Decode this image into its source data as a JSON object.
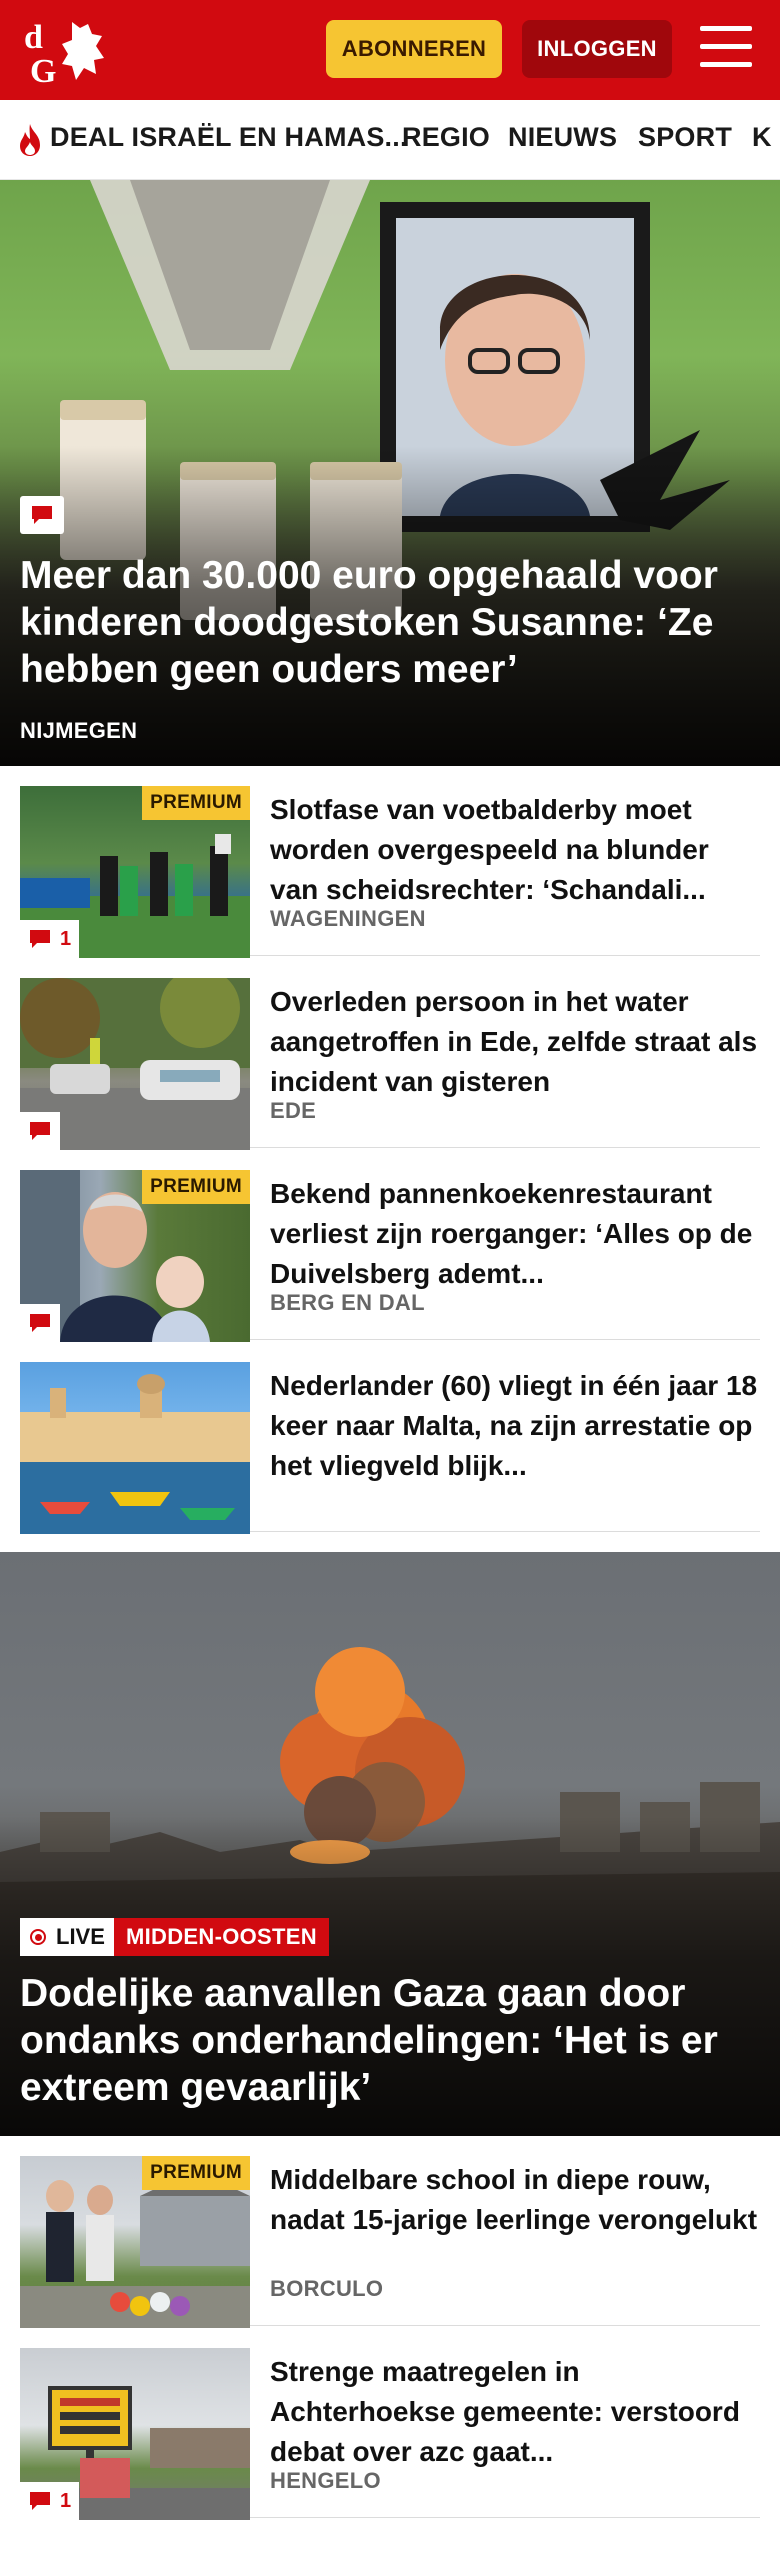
{
  "header": {
    "logo_text": "dG",
    "subscribe_label": "ABONNEREN",
    "login_label": "INLOGGEN",
    "menu_icon": "hamburger-icon",
    "brand_color": "#d10a10"
  },
  "nav": {
    "items": [
      {
        "label": "DEAL ISRAËL EN HAMAS...",
        "icon": "flame-icon"
      },
      {
        "label": "REGIO"
      },
      {
        "label": "NIEUWS"
      },
      {
        "label": "SPORT"
      },
      {
        "label": "K"
      }
    ]
  },
  "hero": {
    "title": "Meer dan 30.000 euro opgehaald voor kinderen doodgestoken Susanne: ‘Ze hebben geen ouders meer’",
    "location": "NIJMEGEN"
  },
  "articles": [
    {
      "title": "Slotfase van voetbalderby moet worden overgespeeld na blunder van scheidsrechter: ‘Schandali...",
      "location": "WAGENINGEN",
      "premium_label": "PREMIUM",
      "comments": "1"
    },
    {
      "title": "Overleden persoon in het water aangetroffen in Ede, zelfde straat als incident van gisteren",
      "location": "EDE"
    },
    {
      "title": "Bekend pannenkoekenrestau­rant verliest zijn roerganger: ‘Alles op de Duivelsberg ademt...",
      "location": "BERG EN DAL",
      "premium_label": "PREMIUM"
    },
    {
      "title": "Nederlander (60) vliegt in één jaar 18 keer naar Malta, na zijn arrestatie op het vliegveld blijk..."
    }
  ],
  "hero2": {
    "live_label": "LIVE",
    "category": "MIDDEN-OOSTEN",
    "title": "Dodelijke aanvallen Gaza gaan door ondanks onderhandelingen: ‘Het is er extreem gevaarlijk’"
  },
  "articles2": [
    {
      "title": "Middelbare school in diepe rouw, nadat 15-jarige leerlinge verongelukt",
      "location": "BORCULO",
      "premium_label": "PREMIUM"
    },
    {
      "title": "Strenge maatregelen in Achterhoekse gemeente: verstoord debat over azc gaat...",
      "location": "HENGELO",
      "comments": "1"
    }
  ]
}
